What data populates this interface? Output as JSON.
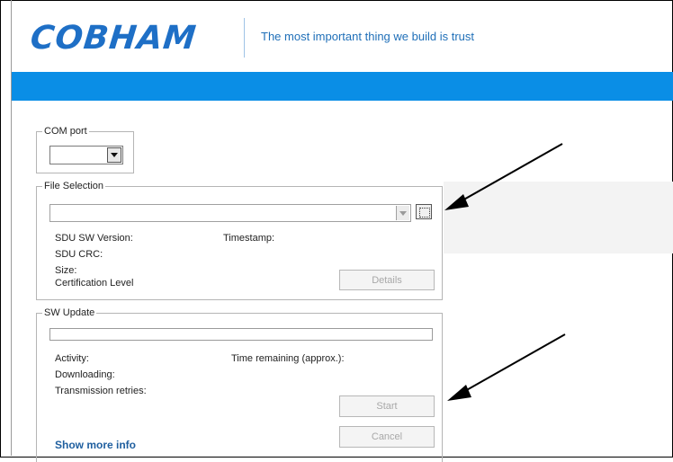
{
  "header": {
    "logo_text": "COBHAM",
    "tagline": "The most important thing we build is trust",
    "brand_color": "#1e6fc6",
    "bar_color": "#0a8ee6"
  },
  "com_port": {
    "group_label": "COM port",
    "value": ""
  },
  "file_selection": {
    "group_label": "File Selection",
    "file_value": "",
    "sdu_sw_version_label": "SDU SW Version:",
    "timestamp_label": "Timestamp:",
    "sdu_crc_label": "SDU CRC:",
    "size_label": "Size:",
    "certification_label": "Certification Level",
    "details_button": "Details"
  },
  "sw_update": {
    "group_label": "SW Update",
    "activity_label": "Activity:",
    "time_remaining_label": "Time remaining (approx.):",
    "downloading_label": "Downloading:",
    "retries_label": "Transmission retries:",
    "start_button": "Start",
    "cancel_button": "Cancel",
    "show_more_link": "Show more info",
    "progress": 0
  }
}
